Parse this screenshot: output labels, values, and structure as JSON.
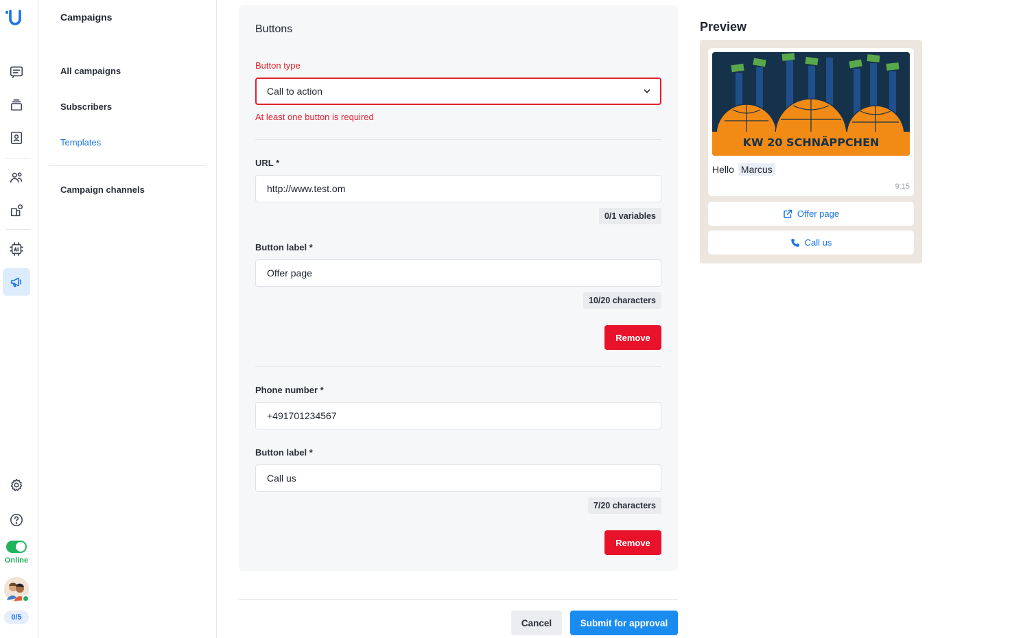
{
  "rail": {
    "status_label": "Online",
    "counter": "0/5",
    "colors": {
      "active_bg": "#dcecfd",
      "online": "#1fb35b",
      "brand": "#1a73e8"
    }
  },
  "nav": {
    "title": "Campaigns",
    "items": [
      {
        "label": "All campaigns"
      },
      {
        "label": "Subscribers"
      },
      {
        "label": "Templates",
        "selected": true
      },
      {
        "label": "Campaign channels"
      }
    ]
  },
  "form": {
    "section_title": "Buttons",
    "button_type": {
      "label": "Button type",
      "value": "Call to action",
      "error": "At least one button is required"
    },
    "url_button": {
      "url_label": "URL *",
      "url_value": "http://www.test.om",
      "url_counter": "0/1 variables",
      "label_label": "Button label *",
      "label_value": "Offer page",
      "label_counter": "10/20 characters",
      "remove_label": "Remove"
    },
    "phone_button": {
      "phone_label": "Phone number *",
      "phone_value": "+491701234567",
      "label_label": "Button label *",
      "label_value": "Call us",
      "label_counter": "7/20 characters",
      "remove_label": "Remove"
    },
    "actions": {
      "cancel_label": "Cancel",
      "submit_label": "Submit for approval"
    }
  },
  "preview": {
    "title": "Preview",
    "banner_text": "KW 20 SCHNÄPPCHEN",
    "greeting": "Hello",
    "variable": "Marcus",
    "time": "9:15",
    "buttons": [
      {
        "label": "Offer page",
        "icon": "external-link-icon"
      },
      {
        "label": "Call us",
        "icon": "phone-icon"
      }
    ],
    "colors": {
      "banner_orange": "#f28a16",
      "banner_bg": "#16324a",
      "chat_bg": "#ece6df"
    }
  }
}
